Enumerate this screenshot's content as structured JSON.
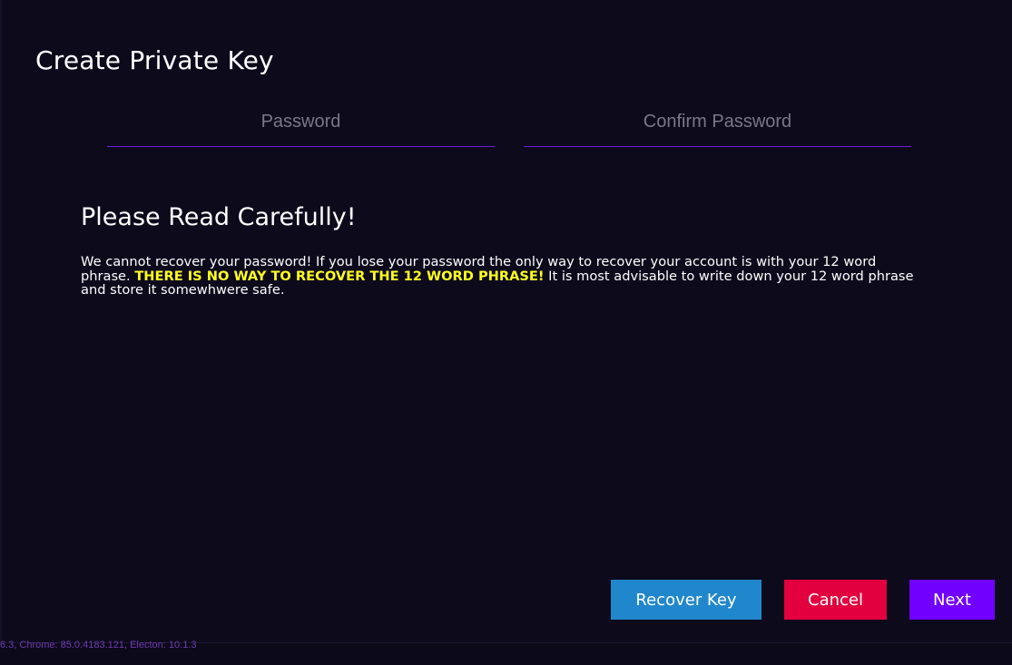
{
  "page": {
    "title": "Create Private Key"
  },
  "form": {
    "password_placeholder": "Password",
    "confirm_password_placeholder": "Confirm Password"
  },
  "warning": {
    "heading": "Please Read Carefully!",
    "text_before": "We cannot recover your password! If you lose your password the only way to recover your account is with your 12 word phrase. ",
    "highlight": "THERE IS NO WAY TO RECOVER THE 12 WORD PHRASE!",
    "text_after": " It is most advisable to write down your 12 word phrase and store it somewhwere safe."
  },
  "actions": {
    "recover_label": "Recover Key",
    "cancel_label": "Cancel",
    "next_label": "Next"
  },
  "footer": {
    "version_text": "6.3, Chrome: 85.0.4183.121, Electon: 10.1.3"
  },
  "colors": {
    "background": "#0d0a1c",
    "accent_purple": "#7100ff",
    "field_underline": "#6a1ee0",
    "recover_blue": "#2187cc",
    "cancel_red": "#e3003f",
    "warning_yellow": "#ffff1f",
    "version_text": "#6f3bb3"
  }
}
